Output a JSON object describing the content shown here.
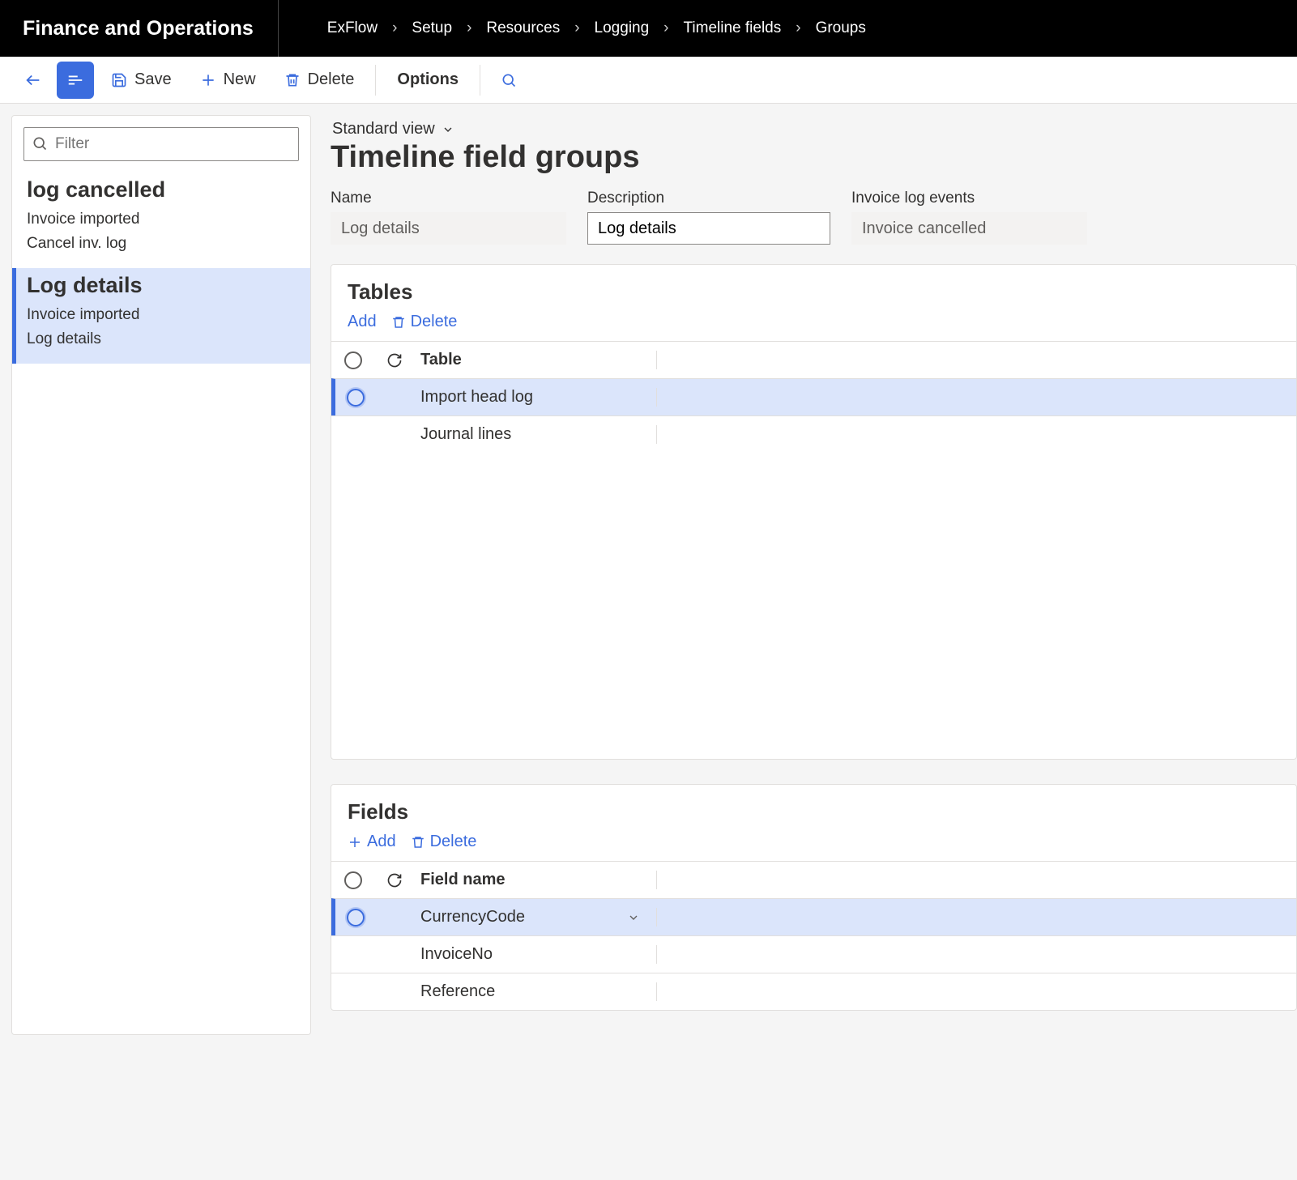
{
  "app_title": "Finance and Operations",
  "breadcrumbs": [
    "ExFlow",
    "Setup",
    "Resources",
    "Logging",
    "Timeline fields",
    "Groups"
  ],
  "actionbar": {
    "save": "Save",
    "new": "New",
    "delete": "Delete",
    "options": "Options"
  },
  "sidebar": {
    "filter_placeholder": "Filter",
    "groups": [
      {
        "title": "log cancelled",
        "lines": [
          "Invoice imported",
          "Cancel inv. log"
        ],
        "selected": false
      },
      {
        "title": "Log details",
        "lines": [
          "Invoice imported",
          "Log details"
        ],
        "selected": true
      }
    ]
  },
  "main": {
    "view_label": "Standard view",
    "page_title": "Timeline field groups",
    "fields": {
      "name_label": "Name",
      "name_value": "Log details",
      "desc_label": "Description",
      "desc_value": "Log details",
      "events_label": "Invoice log events",
      "events_value": "Invoice cancelled"
    },
    "tables_card": {
      "title": "Tables",
      "add": "Add",
      "delete": "Delete",
      "col": "Table",
      "rows": [
        {
          "value": "Import head log",
          "selected": true
        },
        {
          "value": "Journal lines",
          "selected": false
        }
      ]
    },
    "fields_card": {
      "title": "Fields",
      "add": "Add",
      "delete": "Delete",
      "col": "Field name",
      "rows": [
        {
          "value": "CurrencyCode",
          "selected": true,
          "dropdown": true
        },
        {
          "value": "InvoiceNo",
          "selected": false
        },
        {
          "value": "Reference",
          "selected": false
        }
      ]
    }
  }
}
